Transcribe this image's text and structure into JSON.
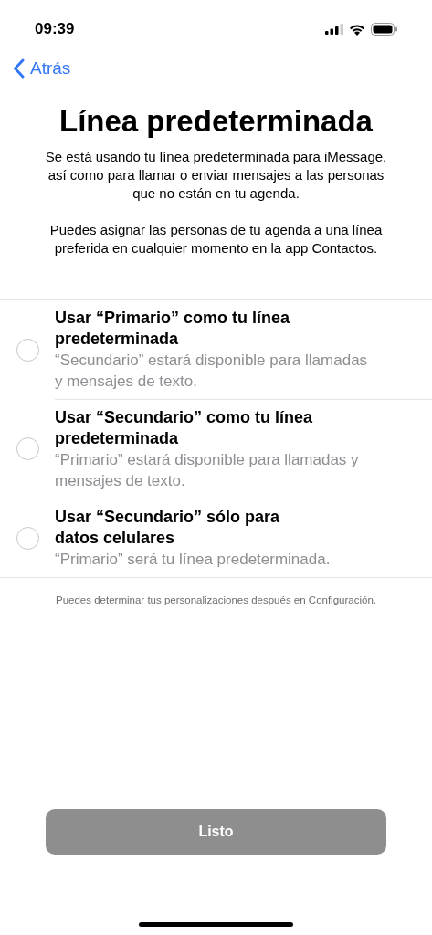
{
  "status_bar": {
    "time": "09:39"
  },
  "nav": {
    "back": "Atrás"
  },
  "title": "Línea predeterminada",
  "paragraphs": [
    "Se está usando tu línea predeterminada para iMessage, así como para llamar o enviar mensajes a las personas que no están en tu agenda.",
    "Puedes asignar las personas de tu agenda a una línea preferida en cualquier momento en la app Contactos."
  ],
  "options": [
    {
      "title": "Usar “Primario” como tu línea predeterminada",
      "subtitle": "“Secundario” estará disponible para llamadas y mensajes de texto.",
      "selected": false
    },
    {
      "title": "Usar “Secundario” como tu línea predeterminada",
      "subtitle": "“Primario” estará disponible para llamadas y mensajes de texto.",
      "selected": false
    },
    {
      "title": "Usar “Secundario” sólo para datos celulares",
      "subtitle": "“Primario” será tu línea predeterminada.",
      "selected": false
    }
  ],
  "footnote": "Puedes determinar tus personalizaciones después en Configuración.",
  "button": {
    "label": "Listo",
    "disabled": true
  }
}
